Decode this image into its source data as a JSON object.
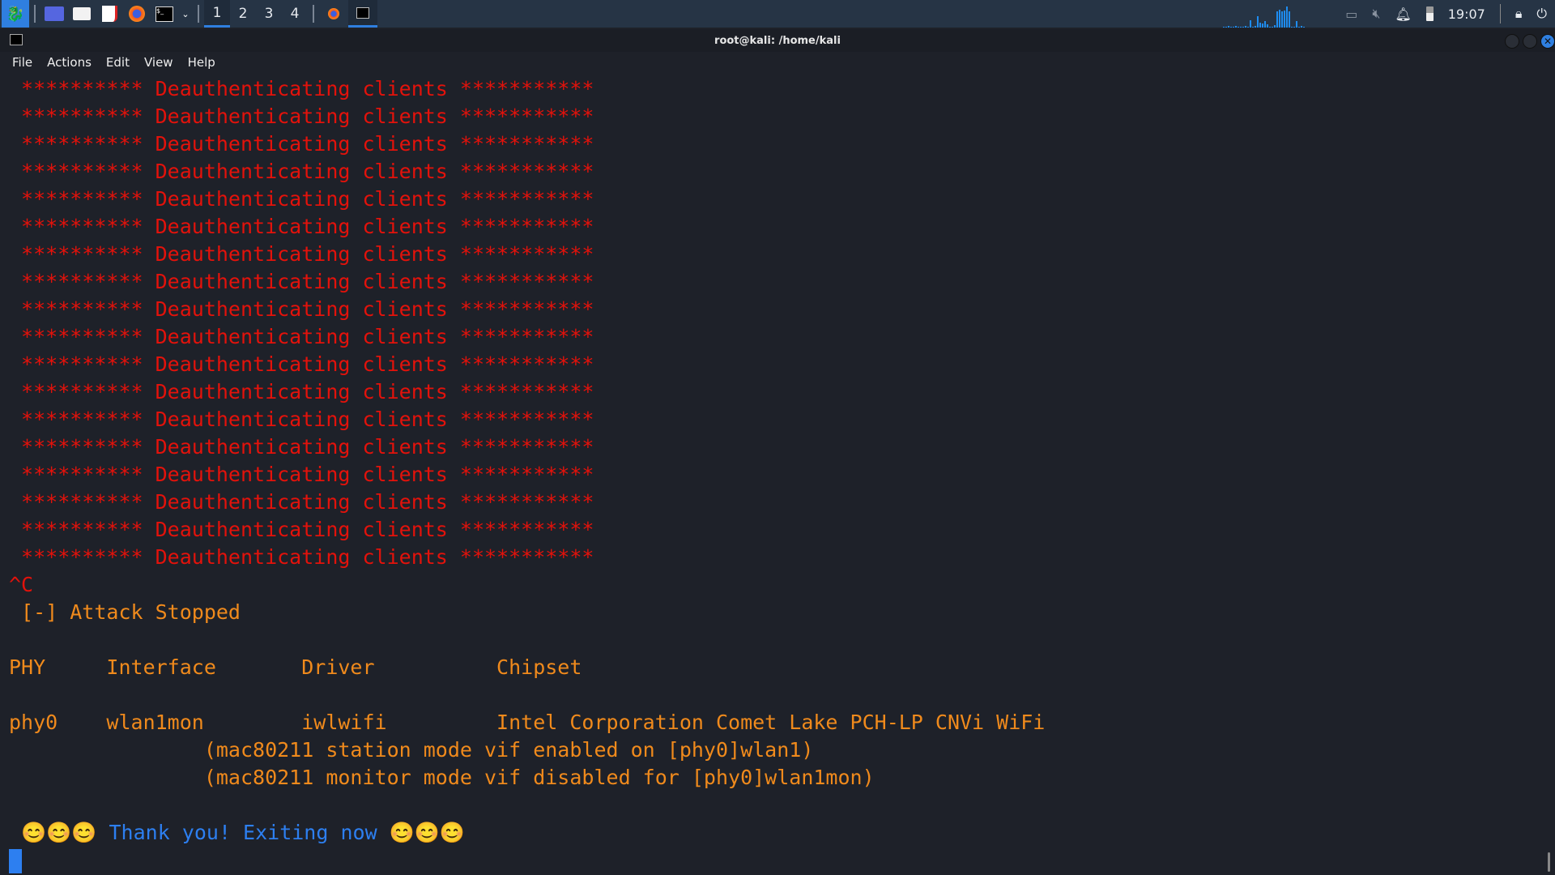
{
  "taskbar": {
    "workspaces": [
      "1",
      "2",
      "3",
      "4"
    ],
    "active_workspace": "1",
    "clock": "19:07",
    "icons": [
      "kali-menu-icon",
      "desktop-icon",
      "file-manager-icon",
      "text-editor-icon",
      "firefox-icon",
      "terminal-icon",
      "chevron-down-icon"
    ],
    "tray_icons": [
      "network-disconnected-icon",
      "volume-muted-icon",
      "notification-bell-icon",
      "battery-icon",
      "lock-icon",
      "logout-icon"
    ]
  },
  "window": {
    "title": "root@kali: /home/kali"
  },
  "menu": [
    "File",
    "Actions",
    "Edit",
    "View",
    "Help"
  ],
  "terminal": {
    "deauth_line": " ********** Deauthenticating clients ***********",
    "deauth_count": 18,
    "interrupt": "^C",
    "attack_stopped": " [-] Attack Stopped",
    "table_header": "PHY     Interface       Driver          Chipset",
    "table_row": "phy0    wlan1mon        iwlwifi         Intel Corporation Comet Lake PCH-LP CNVi WiFi",
    "note1": "                (mac80211 station mode vif enabled on [phy0]wlan1)",
    "note2": "                (mac80211 monitor mode vif disabled for [phy0]wlan1mon)",
    "thanks": " 😊😊😊 Thank you! Exiting now 😊😊😊"
  },
  "colors": {
    "error": "#e3120b",
    "info": "#f08a1c",
    "accent": "#2d7ff0"
  }
}
